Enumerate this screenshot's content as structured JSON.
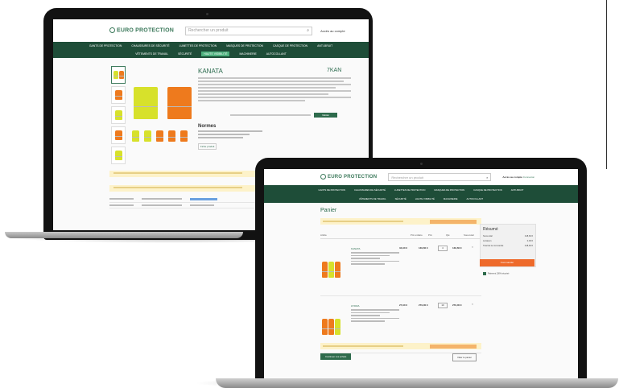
{
  "colors": {
    "brand": "#3d7a5c",
    "nav": "#1e4d38",
    "order": "#ee6a2b",
    "notice": "#fdf2c9"
  },
  "laptop_back": {
    "header": {
      "logo": "EURO PROTECTION",
      "search_placeholder": "Rechercher un produit",
      "search_icon": "search-icon",
      "account": "Accès au compte"
    },
    "nav": {
      "row1": [
        "GANTS DE PROTECTION",
        "CHAUSSURES DE SÉCURITÉ",
        "LUNETTES DE PROTECTION",
        "MASQUES DE PROTECTION",
        "CASQUE DE PROTECTION",
        "ANTI-BRUIT"
      ],
      "row2": [
        "VÊTEMENTS DE TRAVAIL",
        "SÉCURITÉ",
        "HAUTE VISIBILITÉ",
        "MACHINERIE",
        "AUTOCOLLANT"
      ]
    },
    "product": {
      "title": "KANATA",
      "ref": "7KAN",
      "section": "Normes",
      "fiche": "Fiche produit",
      "confirm": "Valider"
    }
  },
  "laptop_front": {
    "header": {
      "logo": "EURO PROTECTION",
      "search_placeholder": "Rechercher un produit",
      "search_icon": "search-icon",
      "account_prefix": "Accès au compte",
      "account_link": "Connexion"
    },
    "nav": {
      "row1": [
        "GANTS DE PROTECTION",
        "CHAUSSURES DE SÉCURITÉ",
        "LUNETTES DE PROTECTION",
        "MASQUES DE PROTECTION",
        "CASQUE DE PROTECTION",
        "ANTI-BRUIT"
      ],
      "row2": [
        "VÊTEMENTS DE TRAVAIL",
        "SÉCURITÉ",
        "HAUTE VISIBILITÉ",
        "MACHINERIE",
        "AUTOCOLLANT"
      ]
    },
    "page_title": "Panier",
    "cart_columns": [
      "Article",
      "Prix unitaire",
      "Prix",
      "Qté",
      "Sous-total"
    ],
    "items": [
      {
        "name": "KANATA",
        "unit": "34,90 €",
        "price": "139,60 €",
        "qty": "4",
        "subtotal": "139,60 €"
      },
      {
        "name": "HYDRA",
        "unit": "27,90 €",
        "price": "279,00 €",
        "qty": "10",
        "subtotal": "279,00 €"
      }
    ],
    "continue": "Continuer vos achats",
    "empty": "Vider le panier",
    "summary": {
      "title": "Résumé",
      "rows": [
        {
          "label": "Sous-total",
          "value": "418,60 €"
        },
        {
          "label": "Livraison",
          "value": "0,00 €"
        },
        {
          "label": "Total de la commande",
          "value": "418,60 €"
        }
      ],
      "order_button": "Commander",
      "secure_text": "Paiement 100% sécurisé"
    }
  }
}
